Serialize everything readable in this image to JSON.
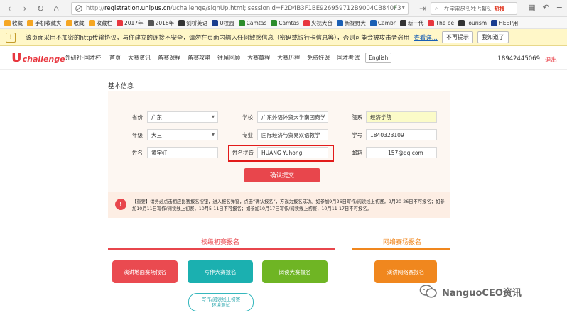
{
  "browser": {
    "url_prefix": "http://",
    "url_host": "registration.unipus.cn",
    "url_path": "/uchallenge/signUp.html;jsessionid=F2D4B3F1BE926959712B9004CB840F3",
    "search_text": "在宇宙尽头独占鳌头",
    "search_hot": "热搜"
  },
  "bookmarks": [
    {
      "label": "收藏",
      "color": "#f5a623"
    },
    {
      "label": "手机收藏夹",
      "color": "#f5a623"
    },
    {
      "label": "收藏",
      "color": "#f5a623"
    },
    {
      "label": "收藏栏",
      "color": "#f5a623"
    },
    {
      "label": "2017年",
      "color": "#e8373f"
    },
    {
      "label": "2018年",
      "color": "#555555"
    },
    {
      "label": "剑桥英语",
      "color": "#333333"
    },
    {
      "label": "U校园",
      "color": "#1a3d8f"
    },
    {
      "label": "Camtas",
      "color": "#2c8c2c"
    },
    {
      "label": "Camtas",
      "color": "#2c8c2c"
    },
    {
      "label": "央视大台",
      "color": "#e8373f"
    },
    {
      "label": "新视野大",
      "color": "#1a5fb4"
    },
    {
      "label": "Cambr",
      "color": "#1a5fb4"
    },
    {
      "label": "新一代",
      "color": "#333333"
    },
    {
      "label": "The be",
      "color": "#e8373f"
    },
    {
      "label": "Tourism",
      "color": "#333333"
    },
    {
      "label": "HEEP用",
      "color": "#1a3d8f"
    }
  ],
  "warning": {
    "text": "该页面采用不加密的http传输协议，与你建立的连接不安全，请勿在页面内输入任何敏感信息（密码或银行卡信息等），否则可能会被攻击者盗用",
    "details_link": "查看详...",
    "no_remind": "不再提示",
    "got_it": "我知道了"
  },
  "header": {
    "logo_u": "U",
    "logo_text": "challenge",
    "logo_sub": "外研社·国才杯",
    "nav": [
      "首页",
      "大赛资讯",
      "备赛课程",
      "备赛攻略",
      "往届回顾",
      "大赛章程",
      "大赛历程",
      "免费好课",
      "国才考试"
    ],
    "english": "English",
    "phone": "18942445069",
    "logout": "退出"
  },
  "form": {
    "section_title": "基本信息",
    "province_label": "省份",
    "province_value": "广东",
    "school_label": "学校",
    "school_value": "广东外语外贸大学南国商学",
    "college_label": "院系",
    "college_value": "经济学院",
    "grade_label": "年级",
    "grade_value": "大三",
    "major_label": "专业",
    "major_value": "国际经济与贸易双语教学",
    "student_id_label": "学号",
    "student_id_value": "1840323109",
    "name_label": "姓名",
    "name_value": "黄宇红",
    "pinyin_label": "姓名拼音",
    "pinyin_value": "HUANG Yuhong",
    "email_label": "邮箱",
    "email_value": "157@qq.com",
    "submit": "确认提交"
  },
  "notice": {
    "icon": "!",
    "text": "【重要】请务必点击相应比赛报名按钮，进入报名弹窗，点击“确认报名”，方视为报名成功。如参加9月26日写作/阅读线上初赛，9月20-26日不可报名；如参加10月11日写作/阅读线上初赛，10月5-11日不可报名；如参加10月17日写作/阅读线上初赛，10月11-17日不可报名。"
  },
  "sections": {
    "school_title": "校级初赛报名",
    "online_title": "网络赛场报名",
    "btn_speech": "演讲地面赛场报名",
    "btn_writing": "写作大赛报名",
    "btn_reading": "阅读大赛报名",
    "btn_online_speech": "演讲网络赛报名",
    "test_line1": "写作/阅读线上初赛",
    "test_line2": "环境测试"
  },
  "colors": {
    "brand_red": "#e8464c",
    "teal": "#1bb0b0",
    "green": "#6fb524",
    "orange": "#f0871e"
  },
  "watermark": "NanguoCEO资讯"
}
